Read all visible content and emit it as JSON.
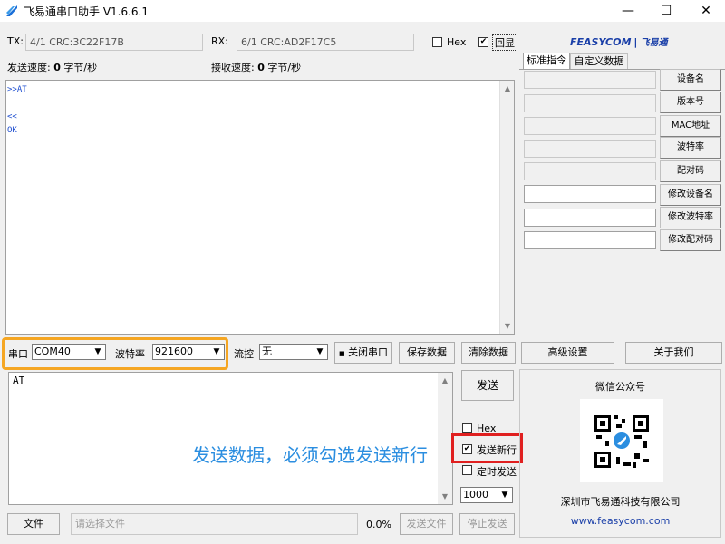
{
  "title": "飞易通串口助手 V1.6.6.1",
  "window_controls": {
    "minimize": "—",
    "maximize": "☐",
    "close": "✕"
  },
  "tx": {
    "label": "TX:",
    "value": "4/1 CRC:3C22F17B"
  },
  "rx": {
    "label": "RX:",
    "value": "6/1 CRC:AD2F17C5"
  },
  "hex_label": "Hex",
  "echo_label": "回显",
  "echo_checked": true,
  "logo": {
    "brand": "FEASYCOM",
    "cn": "飞易通"
  },
  "send_speed": {
    "label": "发送速度:",
    "value": "0",
    "unit": "字节/秒"
  },
  "recv_speed": {
    "label": "接收速度:",
    "value": "0",
    "unit": "字节/秒"
  },
  "terminal": ">>AT\n\n<<\nOK",
  "right_tabs": [
    "标准指令",
    "自定义数据"
  ],
  "cmd_buttons": [
    "设备名",
    "版本号",
    "MAC地址",
    "波特率",
    "配对码",
    "修改设备名",
    "修改波特率",
    "修改配对码"
  ],
  "port": {
    "label": "串口",
    "value": "COM40"
  },
  "baud": {
    "label": "波特率",
    "value": "921600"
  },
  "flow": {
    "label": "流控",
    "value": "无"
  },
  "close_port_button": "关闭串口",
  "save_data_button": "保存数据",
  "clear_data_button": "清除数据",
  "advanced_button": "高级设置",
  "about_button": "关于我们",
  "send_input_value": "AT",
  "send_button": "发送",
  "send_hex_label": "Hex",
  "newline_label": "发送新行",
  "newline_checked": true,
  "timed_send_label": "定时发送",
  "interval_value": "1000",
  "annotation": "发送数据，必须勾选发送新行",
  "wechat_title": "微信公众号",
  "company": "深圳市飞易通科技有限公司",
  "website": "www.feasycom.com",
  "file_button": "文件",
  "file_placeholder": "请选择文件",
  "progress": "0.0%",
  "send_file_button": "发送文件",
  "stop_send_button": "停止发送",
  "colors": {
    "highlight_orange": "#f5a623",
    "highlight_red": "#e02020",
    "annotation_blue": "#2b8ee0",
    "logo_blue": "#1a3fa8",
    "terminal_blue": "#1f4fd0"
  }
}
